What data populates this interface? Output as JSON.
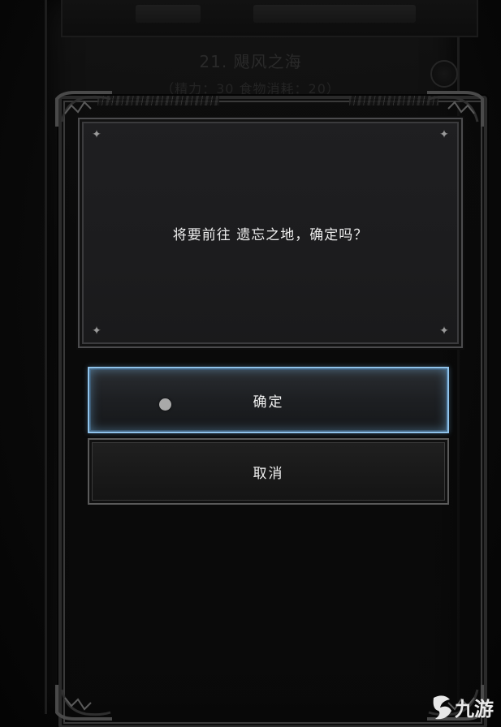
{
  "background": {
    "level_title": "21. 飓风之海",
    "level_cost": "（精力：30    食物消耗：20）"
  },
  "dialog": {
    "message": "将要前往 遗忘之地，确定吗？",
    "confirm_label": "确定",
    "cancel_label": "取消"
  },
  "watermark": {
    "text": "九游"
  },
  "colors": {
    "confirm_glow": "#8fc3ec",
    "panel": "#1e1e20",
    "text": "#ededed"
  }
}
